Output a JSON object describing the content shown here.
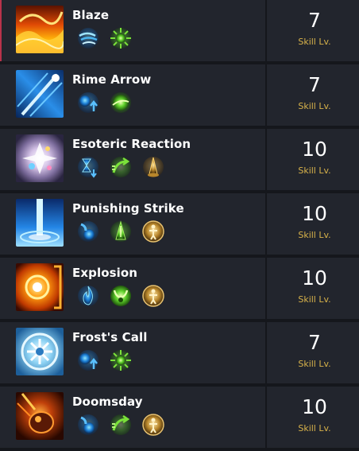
{
  "skills": [
    {
      "name": "Blaze",
      "level": "7",
      "level_label": "Skill Lv.",
      "art": "blaze",
      "tripods": [
        "wind-swirl-icon",
        "green-burst-icon"
      ]
    },
    {
      "name": "Rime Arrow",
      "level": "7",
      "level_label": "Skill Lv.",
      "art": "rime",
      "tripods": [
        "blue-orb-up-icon",
        "green-orb-icon"
      ]
    },
    {
      "name": "Esoteric Reaction",
      "level": "10",
      "level_label": "Skill Lv.",
      "art": "esoteric",
      "tripods": [
        "blue-hourglass-icon",
        "green-arrow-icon",
        "gold-spike-icon"
      ]
    },
    {
      "name": "Punishing Strike",
      "level": "10",
      "level_label": "Skill Lv.",
      "art": "punishing",
      "tripods": [
        "blue-flask-icon",
        "green-spike-icon",
        "gold-figure-icon"
      ]
    },
    {
      "name": "Explosion",
      "level": "10",
      "level_label": "Skill Lv.",
      "art": "explosion",
      "tripods": [
        "blue-flame-icon",
        "green-horns-icon",
        "gold-figure-icon"
      ]
    },
    {
      "name": "Frost's Call",
      "level": "7",
      "level_label": "Skill Lv.",
      "art": "frost",
      "tripods": [
        "blue-orb-up-icon",
        "green-burst-icon"
      ]
    },
    {
      "name": "Doomsday",
      "level": "10",
      "level_label": "Skill Lv.",
      "art": "doomsday",
      "tripods": [
        "blue-flask-icon",
        "green-arrow-icon",
        "gold-figure-icon"
      ]
    }
  ]
}
